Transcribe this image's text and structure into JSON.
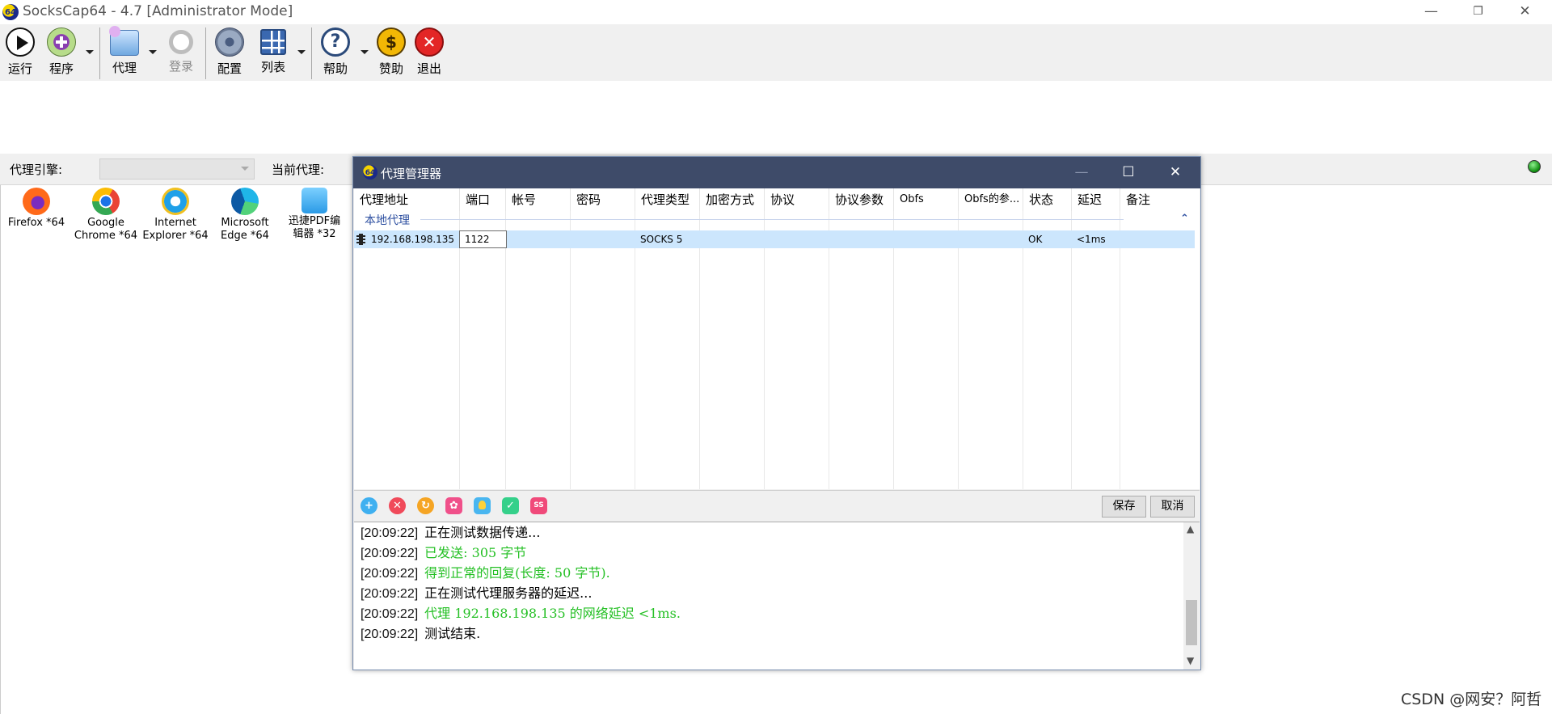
{
  "window": {
    "title": "SocksCap64 - 4.7 [Administrator Mode]",
    "app_icon_text": "64",
    "minimize": "—",
    "restore": "❐",
    "close": "✕"
  },
  "toolbar": {
    "run": "运行",
    "programs": "程序",
    "proxy": "代理",
    "login": "登录",
    "config": "配置",
    "list": "列表",
    "help": "帮助",
    "donate": "赞助",
    "exit": "退出"
  },
  "engine_bar": {
    "engine_label": "代理引擎:",
    "engine_value": "",
    "current_proxy_label": "当前代理:"
  },
  "programs": [
    {
      "line1": "Firefox *64",
      "line2": ""
    },
    {
      "line1": "Google",
      "line2": "Chrome *64"
    },
    {
      "line1": "Internet",
      "line2": "Explorer *64"
    },
    {
      "line1": "Microsoft",
      "line2": "Edge *64"
    },
    {
      "line1": "迅捷PDF编",
      "line2": "辑器 *32"
    }
  ],
  "dialog": {
    "title": "代理管理器",
    "icon_text": "64",
    "minimize": "—",
    "maximize": "☐",
    "close": "✕",
    "columns": [
      "代理地址",
      "端口",
      "帐号",
      "密码",
      "代理类型",
      "加密方式",
      "协议",
      "协议参数",
      "Obfs",
      "Obfs的参...",
      "状态",
      "延迟",
      "备注"
    ],
    "group_label": "本地代理",
    "group_caret": "⌃",
    "row": {
      "address": "192.168.198.135",
      "port": "1122",
      "account": "",
      "password": "",
      "type": "SOCKS 5",
      "encryption": "",
      "protocol": "",
      "protocol_params": "",
      "obfs": "",
      "obfs_params": "",
      "status": "OK",
      "latency": "<1ms",
      "note": ""
    },
    "save": "保存",
    "cancel": "取消",
    "action_icons": [
      "add-icon",
      "delete-icon",
      "refresh-icon",
      "settings-icon",
      "tip-icon",
      "check-icon",
      "ss-icon"
    ],
    "ss_text": "SS",
    "log": [
      {
        "time": "[20:09:22]",
        "msg": "正在测试数据传递...",
        "color": "default"
      },
      {
        "time": "[20:09:22]",
        "msg": "已发送: 305 字节",
        "color": "green"
      },
      {
        "time": "[20:09:22]",
        "msg": "得到正常的回复(长度: 50 字节).",
        "color": "green"
      },
      {
        "time": "[20:09:22]",
        "msg": "正在测试代理服务器的延迟...",
        "color": "default"
      },
      {
        "time": "[20:09:22]",
        "msg": "代理 192.168.198.135 的网络延迟 <1ms.",
        "color": "green"
      },
      {
        "time": "[20:09:22]",
        "msg": "测试结束.",
        "color": "default"
      }
    ]
  },
  "watermark": "CSDN @网安？阿哲",
  "colors": {
    "dialog_title_bg": "#3e4b69",
    "selected_row": "#cce6fd",
    "log_green": "#25c025",
    "group_blue": "#2d4fa0"
  }
}
